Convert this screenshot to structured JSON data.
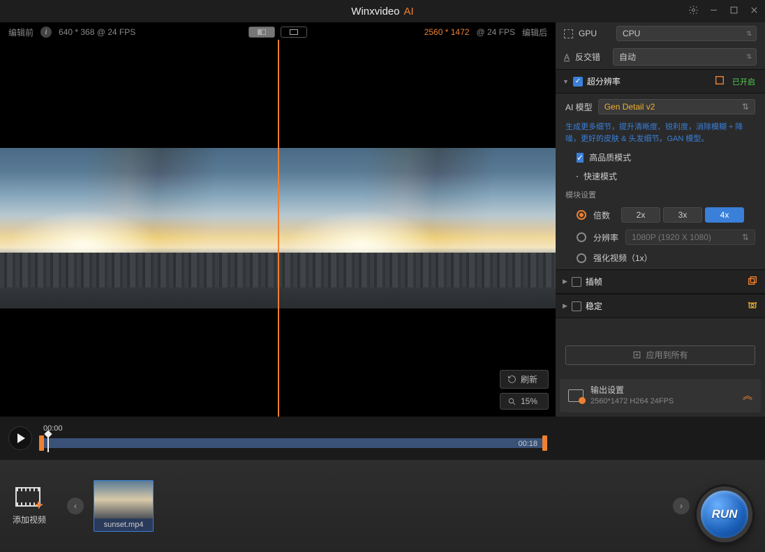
{
  "app": {
    "name_a": "Winxvideo",
    "name_b": "AI"
  },
  "header": {
    "before_label": "编辑前",
    "src_res": "640 * 368 @ 24 FPS",
    "after_label": "编辑后",
    "out_res": "2560 * 1472",
    "out_fps": "@ 24 FPS"
  },
  "tools": {
    "refresh": "刷新",
    "zoom": "15%"
  },
  "player": {
    "start": "00:00",
    "end": "00:18"
  },
  "sidebar": {
    "gpu_label": "GPU",
    "gpu_value": "CPU",
    "deint_label": "反交错",
    "deint_value": "自动",
    "sr": {
      "title": "超分辨率",
      "status": "已开启",
      "model_label": "AI 模型",
      "model_value": "Gen Detail v2",
      "desc": "生成更多细节，提升清晰度、锐利度，消除模糊 + 降噪，更好的皮肤 & 头发细节。GAN 模型。",
      "hq": "高品质模式",
      "fast": "快速模式",
      "module_label": "模块设置",
      "scale_label": "倍数",
      "scale_opts": [
        "2x",
        "3x",
        "4x"
      ],
      "res_label": "分辨率",
      "res_value": "1080P (1920 X 1080)",
      "enhance_label": "强化视频（1x）"
    },
    "interp": "插帧",
    "stab": "稳定",
    "apply_all": "应用到所有"
  },
  "output": {
    "title": "输出设置",
    "detail": "2560*1472  H264  24FPS"
  },
  "bottom": {
    "add": "添加视频",
    "file": "sunset.mp4"
  },
  "run": "RUN"
}
